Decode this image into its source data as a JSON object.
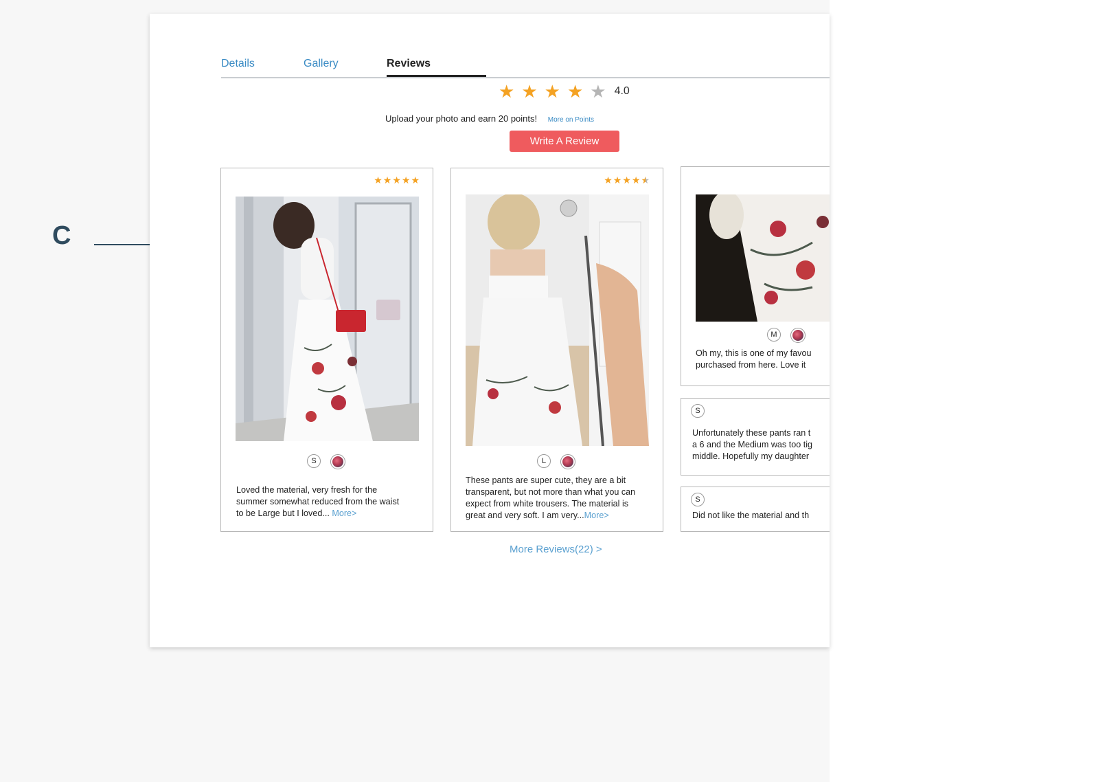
{
  "tabs": [
    {
      "label": "Details",
      "active": false
    },
    {
      "label": "Gallery",
      "active": false
    },
    {
      "label": "Reviews",
      "active": true
    }
  ],
  "rating": {
    "value": "4.0",
    "stars_filled": 4,
    "stars_total": 5
  },
  "promo": {
    "text": "Upload your photo and earn 20 points!",
    "link": "More on Points"
  },
  "write_review_label": "Write A Review",
  "reviews": [
    {
      "stars": 5,
      "size": "S",
      "lines": [
        "Loved the material, very fresh for the",
        "summer somewhat reduced from the waist",
        "to be Large but I loved..."
      ],
      "more": "More>"
    },
    {
      "stars": 4.5,
      "size": "L",
      "lines": [
        "These pants are super cute, they are a bit",
        "transparent, but not more than what you can",
        "expect from white trousers. The material is",
        "great and very soft. I am very..."
      ],
      "more": "More>"
    },
    {
      "size": "M",
      "lines": [
        "Oh my, this is one of my favou",
        "purchased from here. Love it"
      ]
    },
    {
      "size": "S",
      "lines": [
        "Unfortunately these pants ran t",
        "a 6 and the Medium was too tig",
        "middle. Hopefully my daughter"
      ]
    },
    {
      "size": "S",
      "lines": [
        "Did not like the material and th"
      ]
    }
  ],
  "more_reviews_label": "More Reviews(22) >",
  "annotation": {
    "letter": "C"
  },
  "colors": {
    "accent": "#ef5b5e",
    "link": "#3a8bc4",
    "star": "#f4a223",
    "annotation": "#2f4b5e"
  }
}
